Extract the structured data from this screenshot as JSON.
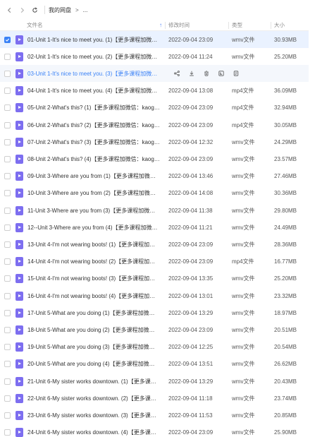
{
  "breadcrumb": {
    "root": "我的网盘",
    "separator": ">",
    "more": "..."
  },
  "columns": {
    "name": "文件名",
    "modified": "修改时间",
    "type": "类型",
    "size": "大小"
  },
  "files": [
    {
      "name": "01-Unit 1-It's nice to meet you. (1)【更多课程加微信…",
      "modified": "2022-09-04 23:09",
      "type": "wmv文件",
      "size": "30.93MB",
      "selected": true
    },
    {
      "name": "02-Unit 1-It's nice to meet you. (2)【更多课程加微信…",
      "modified": "2022-09-04 11:24",
      "type": "wmv文件",
      "size": "25.20MB"
    },
    {
      "name": "03-Unit 1-It's nice to meet you. (3)【更多课程加微信…",
      "modified": "",
      "type": "",
      "size": "",
      "hovered": true
    },
    {
      "name": "04-Unit 1-It's nice to meet you. (4)【更多课程加微信…",
      "modified": "2022-09-04 13:08",
      "type": "mp4文件",
      "size": "36.09MB"
    },
    {
      "name": "05-Unit 2-What's this? (1)【更多课程加微信：kaogao…",
      "modified": "2022-09-04 23:09",
      "type": "mp4文件",
      "size": "32.94MB"
    },
    {
      "name": "06-Unit 2-What's this? (2)【更多课程加微信：kaogao…",
      "modified": "2022-09-04 23:09",
      "type": "mp4文件",
      "size": "30.05MB"
    },
    {
      "name": "07-Unit 2-What's this? (3)【更多课程加微信：kaogao…",
      "modified": "2022-09-04 12:32",
      "type": "wmv文件",
      "size": "24.29MB"
    },
    {
      "name": "08-Unit 2-What's this? (4)【更多课程加微信：kaogao…",
      "modified": "2022-09-04 23:09",
      "type": "wmv文件",
      "size": "23.57MB"
    },
    {
      "name": "09-Unit 3-Where are you from (1)【更多课程加微信…",
      "modified": "2022-09-04 13:46",
      "type": "wmv文件",
      "size": "27.46MB"
    },
    {
      "name": "10-Unit 3-Where are you from (2)【更多课程加微信…",
      "modified": "2022-09-04 14:08",
      "type": "wmv文件",
      "size": "30.36MB"
    },
    {
      "name": "11-Unit 3-Where are you from (3)【更多课程加微信…",
      "modified": "2022-09-04 11:38",
      "type": "wmv文件",
      "size": "29.80MB"
    },
    {
      "name": "12--Unit 3-Where are you from (4)【更多课程加微信…",
      "modified": "2022-09-04 11:21",
      "type": "wmv文件",
      "size": "24.49MB"
    },
    {
      "name": "13-Unit 4-I'm not wearing boots! (1)【更多课程加微…",
      "modified": "2022-09-04 23:09",
      "type": "wmv文件",
      "size": "28.36MB"
    },
    {
      "name": "14-Unit 4-I'm not wearing boots! (2)【更多课程加微…",
      "modified": "2022-09-04 23:09",
      "type": "mp4文件",
      "size": "16.77MB"
    },
    {
      "name": "15-Unit 4-I'm not wearing boots! (3)【更多课程加微…",
      "modified": "2022-09-04 13:35",
      "type": "wmv文件",
      "size": "25.20MB"
    },
    {
      "name": "16-Unit 4-I'm not wearing boots! (4)【更多课程加微…",
      "modified": "2022-09-04 13:01",
      "type": "wmv文件",
      "size": "23.32MB"
    },
    {
      "name": "17-Unit 5-What are you doing (1)【更多课程加微信…",
      "modified": "2022-09-04 13:29",
      "type": "wmv文件",
      "size": "18.97MB"
    },
    {
      "name": "18-Unit 5-What are you doing (2)【更多课程加微信…",
      "modified": "2022-09-04 23:09",
      "type": "wmv文件",
      "size": "20.51MB"
    },
    {
      "name": "19-Unit 5-What are you doing (3)【更多课程加微信…",
      "modified": "2022-09-04 12:25",
      "type": "wmv文件",
      "size": "20.54MB"
    },
    {
      "name": "20-Unit 5-What are you doing (4)【更多课程加微信…",
      "modified": "2022-09-04 13:51",
      "type": "wmv文件",
      "size": "26.62MB"
    },
    {
      "name": "21-Unit 6-My sister works downtown. (1)【更多课程…",
      "modified": "2022-09-04 13:29",
      "type": "wmv文件",
      "size": "20.43MB"
    },
    {
      "name": "22-Unit 6-My sister works downtown. (2)【更多课程…",
      "modified": "2022-09-04 11:18",
      "type": "wmv文件",
      "size": "23.74MB"
    },
    {
      "name": "23-Unit 6-My sister works downtown. (3)【更多课程…",
      "modified": "2022-09-04 11:53",
      "type": "wmv文件",
      "size": "20.85MB"
    },
    {
      "name": "24-Unit 6-My sister works downtown. (4)【更多课程…",
      "modified": "2022-09-04 23:09",
      "type": "wmv文件",
      "size": "25.90MB"
    }
  ],
  "row_action_icons": [
    "share-icon",
    "download-icon",
    "delete-icon",
    "rename-icon",
    "more-icon"
  ],
  "colors": {
    "accent": "#3b82f6",
    "selected_row": "#eaf2ff",
    "video_icon": "#7d6ef0"
  }
}
